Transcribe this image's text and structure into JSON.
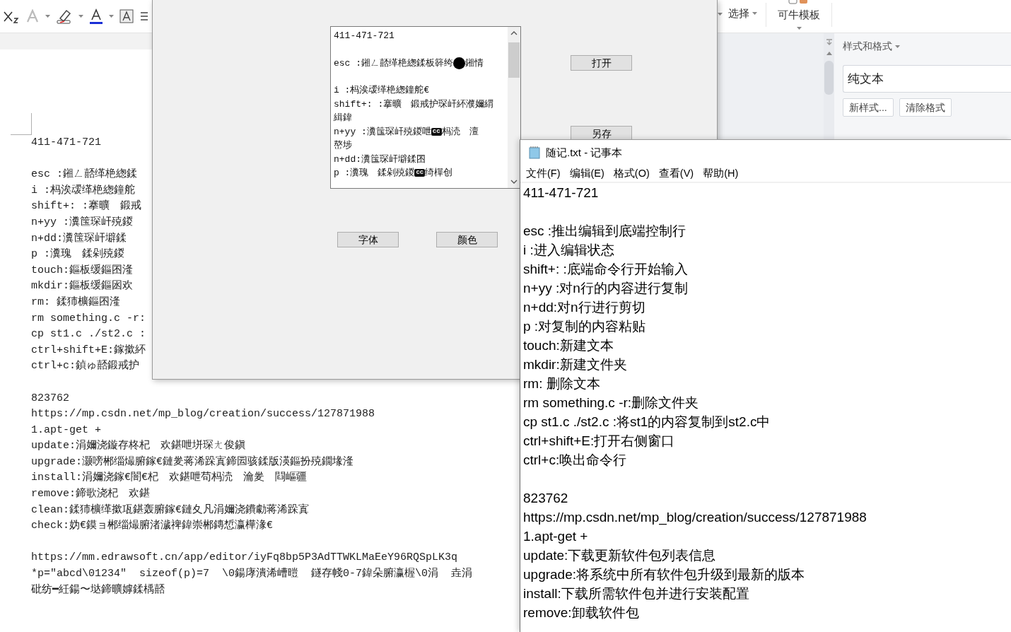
{
  "ribbon": {
    "select_label": "选择",
    "template_label": "可牛模板"
  },
  "styles_pane": {
    "title": "样式和格式",
    "current_style": "纯文本",
    "buttons": [
      "新样式...",
      "清除格式"
    ]
  },
  "document": {
    "blocks": [
      [
        "411-471-721"
      ],
      [
        "esc :鎺ㄥ嚭缂栬緫鍒",
        "i :杩涘叆缂栬緫鐘舵",
        "shift+: :搴曠　鍛戒",
        "n+yy :瀵筺琛屽殑鍐",
        "n+dd:瀵筺琛屽壀鍒",
        "p :瀵瑰　鍒剁殑鍐",
        "touch:鏂板缓鏂囨湰",
        "mkdir:鏂板缓鏂囦欢",
        "rm: 鍒犻櫎鏂囨湰",
        "rm something.c -r:",
        "cp st1.c ./st2.c :",
        "ctrl+shift+E:鎵撳紑",
        "ctrl+c:鍞ゅ嚭鍛戒护"
      ],
      [
        "823762",
        "https://mp.csdn.net/mp_blog/creation/success/127871988",
        "1.apt-get +",
        "update:涓嬭浇鏇存柊杞　欢鍖呭垪琛ㄤ俊鎭",
        "upgrade:灏嗙郴缁熶腑鎵€鏈夎蒋浠跺寘鍗囩骇鍒版渶鏂扮殑鐗堟湰",
        "install:涓嬭浇鎵€闇€杞　欢鍖呭苟杩涜　瀹夎　閰嶇疆",
        "remove:鍗歌浇杞　欢鍖",
        "clean:鍒犻櫎缂撳瓨鍖轰腑鎵€鏈夊凡涓嬭浇鐨勮蒋浠跺寘",
        "check:妫€鏌ョ郴缁熶腑渚濊禆鍏崇郴鏄惁瀛樺湪€"
      ],
      [
        "https://mm.edrawsoft.cn/app/editor/iyFq8bp5P3AdTTWKLMaEeY96RQSpLK3q",
        "*p=\"abcd\\01234\"  sizeof(p)=7  \\0鍚庨潰浠嶆暟  鐩存帴0-7鍏朵腑瀛楃\\0涓  垚涓",
        "砒纺━紝鍚〜垯鍗曠嫭鍒楀嚭"
      ]
    ]
  },
  "dialog": {
    "text_blocks": [
      [
        {
          "parts": [
            {
              "kind": "text",
              "text": "411-471-721"
            }
          ]
        }
      ],
      [
        {
          "parts": [
            {
              "kind": "text",
              "text": "esc :鎺ㄥ嚭缂栬緫鍒板簳绔"
            },
            {
              "kind": "dot"
            },
            {
              "kind": "text",
              "text": "鎺情"
            }
          ]
        }
      ],
      [
        {
          "parts": [
            {
              "kind": "text",
              "text": "i :杩涘叆缂栬緫鐘舵€"
            }
          ]
        },
        {
          "parts": [
            {
              "kind": "text",
              "text": "shift+: :搴曠　鍛戒护琛屽紑濮嬭緭"
            }
          ]
        },
        {
          "parts": [
            {
              "kind": "text",
              "text": "緝鍏"
            }
          ]
        },
        {
          "parts": [
            {
              "kind": "text",
              "text": "n+yy :瀵筺琛屽殑鍐呭"
            },
            {
              "kind": "cc",
              "text": "cc"
            },
            {
              "kind": "text",
              "text": "杩涜　澶"
            }
          ]
        },
        {
          "parts": [
            {
              "kind": "text",
              "text": "嶅埗"
            }
          ]
        },
        {
          "parts": [
            {
              "kind": "text",
              "text": "n+dd:瀵筺琛屽壀鍒囨"
            }
          ]
        },
        {
          "parts": [
            {
              "kind": "text",
              "text": "p :瀵瑰　鍒剁殑鍐"
            },
            {
              "kind": "cc",
              "text": "cc"
            },
            {
              "kind": "text",
              "text": "绮樿创"
            }
          ]
        }
      ]
    ],
    "side_buttons": [
      "打开",
      "另存"
    ],
    "bottom_buttons": [
      "字体",
      "颜色"
    ]
  },
  "notepad": {
    "title": "随记.txt - 记事本",
    "menus": [
      "文件(F)",
      "编辑(E)",
      "格式(O)",
      "查看(V)",
      "帮助(H)"
    ],
    "blocks": [
      [
        "411-471-721"
      ],
      [
        "esc :推出编辑到底端控制行",
        "i :进入编辑状态",
        "shift+: :底端命令行开始输入",
        "n+yy :对n行的内容进行复制",
        "n+dd:对n行进行剪切",
        "p :对复制的内容粘贴",
        "touch:新建文本",
        "mkdir:新建文件夹",
        "rm: 删除文本",
        "rm something.c -r:删除文件夹",
        "cp st1.c ./st2.c :将st1的内容复制到st2.c中",
        "ctrl+shift+E:打开右侧窗口",
        "ctrl+c:唤出命令行"
      ],
      [
        "823762",
        "https://mp.csdn.net/mp_blog/creation/success/127871988",
        "1.apt-get +",
        "update:下载更新软件包列表信息",
        "upgrade:将系统中所有软件包升级到最新的版本",
        "install:下载所需软件包并进行安装配置",
        "remove:卸载软件包"
      ]
    ]
  }
}
